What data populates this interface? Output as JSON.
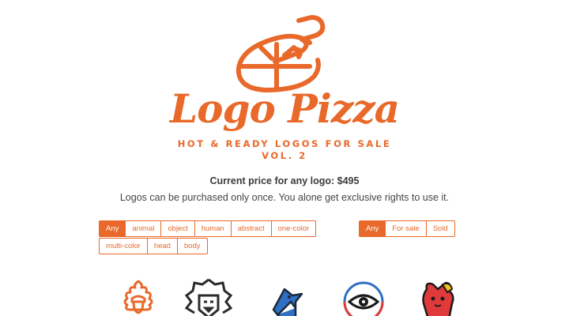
{
  "brand": {
    "name": "Logo Pizza",
    "tagline_line1": "HOT & READY LOGOS FOR SALE",
    "tagline_line2": "VOL. 2",
    "accent": "#e8692a"
  },
  "pricing": {
    "label": "Current price for any logo:",
    "value": "$495"
  },
  "description": "Logos can be purchased only once. You alone get exclusive rights to use it.",
  "category_filters": {
    "row1": [
      "Any",
      "animal",
      "object",
      "human",
      "abstract",
      "one-color"
    ],
    "row2": [
      "multi-color",
      "head",
      "body"
    ],
    "selected": "Any"
  },
  "sale_filters": {
    "options": [
      "Any",
      "For sale",
      "Sold"
    ],
    "selected": "Any"
  },
  "thumbnails": [
    {
      "icon": "oak-leaf-acorn-icon"
    },
    {
      "icon": "lion-head-icon"
    },
    {
      "icon": "blue-jay-icon"
    },
    {
      "icon": "eye-circle-icon"
    },
    {
      "icon": "red-creature-icon"
    }
  ]
}
